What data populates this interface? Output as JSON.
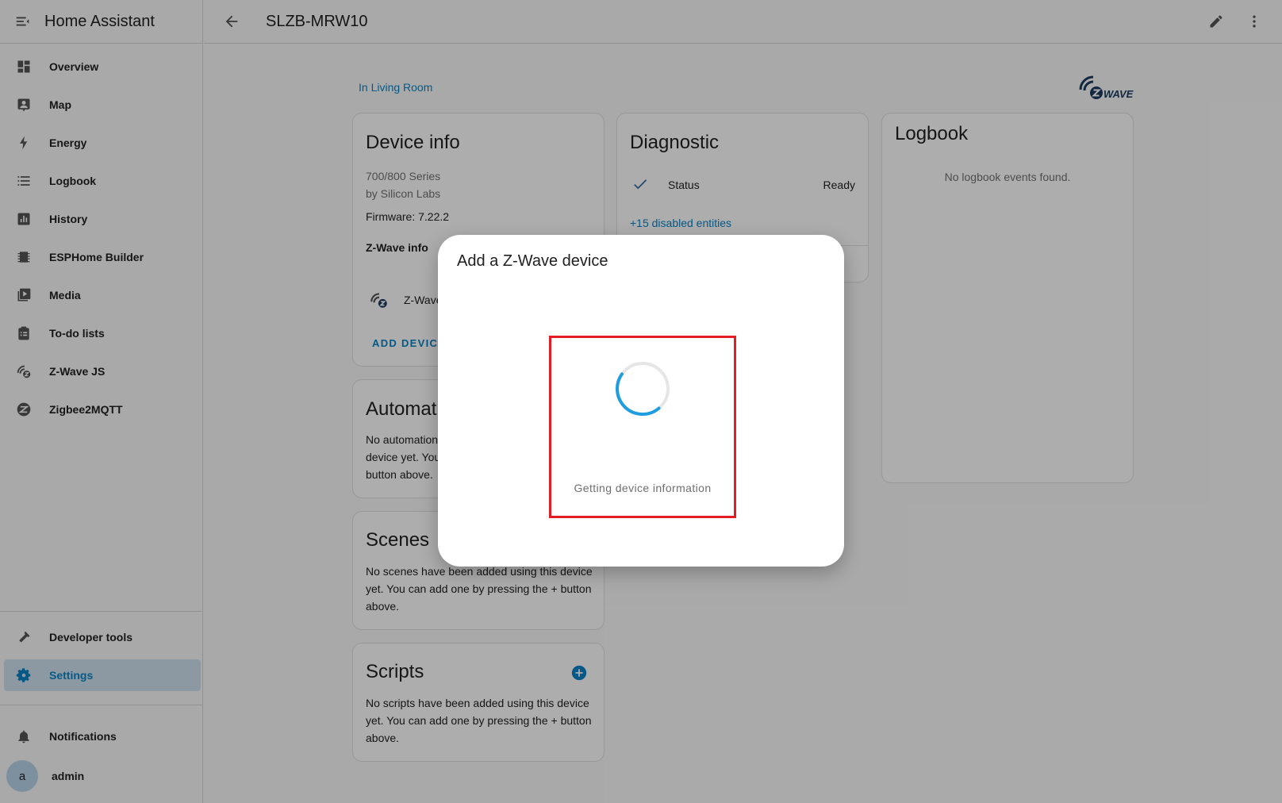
{
  "app": {
    "title": "Home Assistant"
  },
  "sidebar": {
    "items": [
      {
        "label": "Overview",
        "icon": "dashboard-icon"
      },
      {
        "label": "Map",
        "icon": "map-person-icon"
      },
      {
        "label": "Energy",
        "icon": "lightning-icon"
      },
      {
        "label": "Logbook",
        "icon": "list-icon"
      },
      {
        "label": "History",
        "icon": "chart-box-icon"
      },
      {
        "label": "ESPHome Builder",
        "icon": "chip-icon"
      },
      {
        "label": "Media",
        "icon": "media-icon"
      },
      {
        "label": "To-do lists",
        "icon": "clipboard-list-icon"
      },
      {
        "label": "Z-Wave JS",
        "icon": "zwave-icon"
      },
      {
        "label": "Zigbee2MQTT",
        "icon": "zigbee-icon"
      }
    ],
    "bottom": [
      {
        "label": "Developer tools",
        "icon": "hammer-icon"
      },
      {
        "label": "Settings",
        "icon": "gear-icon",
        "active": true
      }
    ],
    "notifications_label": "Notifications",
    "user": {
      "initial": "a",
      "name": "admin"
    }
  },
  "header": {
    "title": "SLZB-MRW10"
  },
  "device": {
    "area_link": "In Living Room"
  },
  "device_info": {
    "title": "Device info",
    "model": "700/800 Series",
    "manufacturer": "by Silicon Labs",
    "firmware": "Firmware: 7.22.2",
    "zwave_info_label": "Z-Wave info",
    "zwave_row_label": "Z-Wave",
    "add_device_label": "ADD DEVICE"
  },
  "diagnostic": {
    "title": "Diagnostic",
    "status_label": "Status",
    "status_value": "Ready",
    "disabled_entities": "+15 disabled entities"
  },
  "logbook": {
    "title": "Logbook",
    "empty": "No logbook events found."
  },
  "automations": {
    "title": "Automat",
    "text_lines": [
      "No automation",
      "device yet. You",
      "button above."
    ]
  },
  "scenes": {
    "title": "Scenes",
    "text_lines": [
      "No scenes have been added using this device",
      "yet. You can add one by pressing the + button",
      "above."
    ]
  },
  "scripts": {
    "title": "Scripts",
    "text_lines": [
      "No scripts have been added using this device",
      "yet. You can add one by pressing the + button",
      "above."
    ]
  },
  "dialog": {
    "title": "Add a Z-Wave device",
    "status": "Getting device information"
  },
  "colors": {
    "accent": "#0a84c6",
    "highlight": "#e21d24",
    "active_bg": "#cfe2f0"
  }
}
